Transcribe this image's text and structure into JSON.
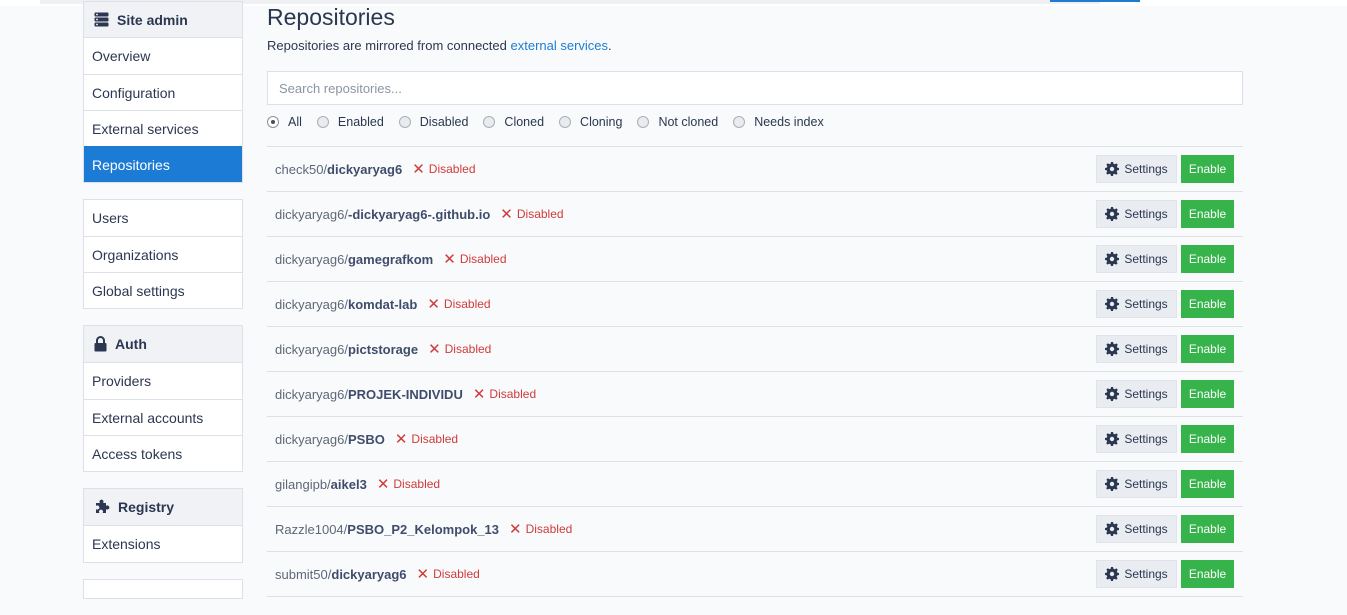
{
  "sidebar": {
    "site_admin": {
      "title": "Site admin",
      "items": [
        "Overview",
        "Configuration",
        "External services",
        "Repositories"
      ],
      "active": "Repositories"
    },
    "users_group": {
      "items": [
        "Users",
        "Organizations",
        "Global settings"
      ]
    },
    "auth": {
      "title": "Auth",
      "items": [
        "Providers",
        "External accounts",
        "Access tokens"
      ]
    },
    "registry": {
      "title": "Registry",
      "items": [
        "Extensions"
      ]
    }
  },
  "main": {
    "title": "Repositories",
    "subtitle_prefix": "Repositories are mirrored from connected ",
    "subtitle_link": "external services",
    "subtitle_suffix": ".",
    "search_placeholder": "Search repositories...",
    "filters": [
      "All",
      "Enabled",
      "Disabled",
      "Cloned",
      "Cloning",
      "Not cloned",
      "Needs index"
    ],
    "selected_filter": "All",
    "settings_label": "Settings",
    "enable_label": "Enable",
    "repos": [
      {
        "owner": "check50/",
        "name": "dickyaryag6",
        "status": "Disabled"
      },
      {
        "owner": "dickyaryag6/",
        "name": "-dickyaryag6-.github.io",
        "status": "Disabled"
      },
      {
        "owner": "dickyaryag6/",
        "name": "gamegrafkom",
        "status": "Disabled"
      },
      {
        "owner": "dickyaryag6/",
        "name": "komdat-lab",
        "status": "Disabled"
      },
      {
        "owner": "dickyaryag6/",
        "name": "pictstorage",
        "status": "Disabled"
      },
      {
        "owner": "dickyaryag6/",
        "name": "PROJEK-INDIVIDU",
        "status": "Disabled"
      },
      {
        "owner": "dickyaryag6/",
        "name": "PSBO",
        "status": "Disabled"
      },
      {
        "owner": "gilangipb/",
        "name": "aikel3",
        "status": "Disabled"
      },
      {
        "owner": "Razzle1004/",
        "name": "PSBO_P2_Kelompok_13",
        "status": "Disabled"
      },
      {
        "owner": "submit50/",
        "name": "dickyaryag6",
        "status": "Disabled"
      }
    ]
  },
  "colors": {
    "accent": "#1c7cd5",
    "enable": "#36b34a",
    "disabled_status": "#d03b3b"
  }
}
